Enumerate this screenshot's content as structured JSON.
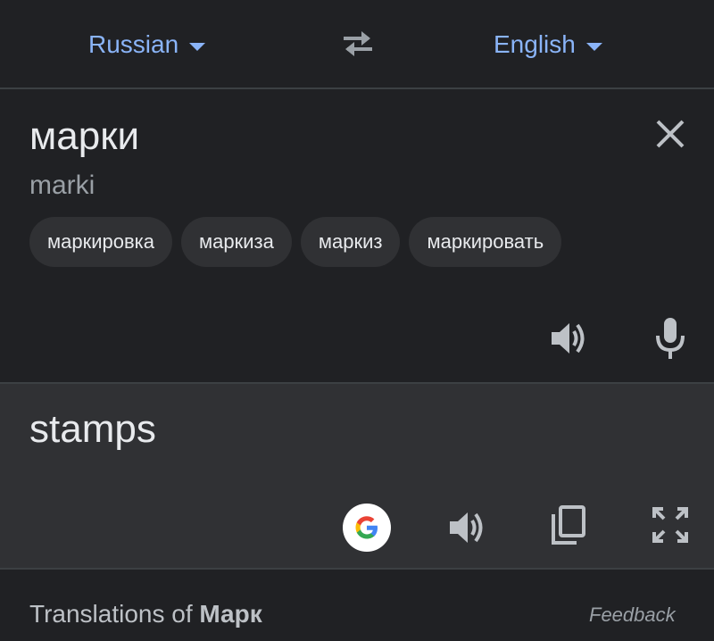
{
  "header": {
    "source_lang": "Russian",
    "target_lang": "English",
    "swap_icon": "swap-arrows-icon",
    "caret_icon": "caret-down-icon"
  },
  "source": {
    "text": "марки",
    "transliteration": "marki",
    "suggestions": [
      "маркировка",
      "маркиза",
      "маркиз",
      "маркировать"
    ],
    "clear_icon": "close-icon",
    "speak_icon": "speaker-icon",
    "mic_icon": "microphone-icon"
  },
  "result": {
    "text": "stamps",
    "google_icon": "google-logo-icon",
    "speak_icon": "speaker-icon",
    "copy_icon": "copy-icon",
    "fullscreen_icon": "fullscreen-icon"
  },
  "footer": {
    "title_prefix": "Translations of ",
    "title_word": "Марк",
    "feedback": "Feedback"
  },
  "colors": {
    "background": "#202124",
    "result_background": "#303134",
    "accent": "#8ab4f8",
    "chip_background": "#303134",
    "divider": "#3c4043",
    "icon": "#bdc1c6"
  }
}
